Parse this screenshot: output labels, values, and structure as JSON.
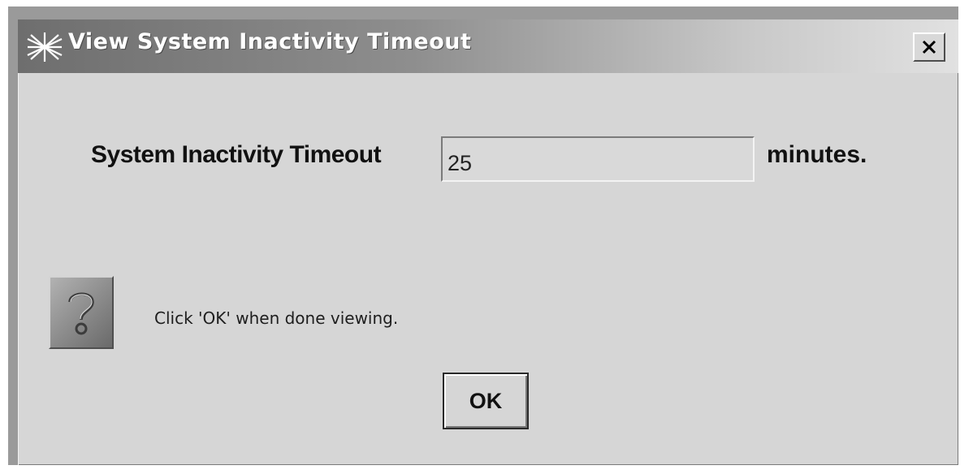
{
  "window": {
    "title": "View System Inactivity Timeout",
    "app_icon": "asterisk-logo-icon",
    "close_icon": "close-icon"
  },
  "form": {
    "field_label": "System Inactivity Timeout",
    "timeout_value": "25",
    "units_label": "minutes."
  },
  "help": {
    "icon": "question-icon",
    "message": "Click 'OK' when done viewing."
  },
  "actions": {
    "ok_label": "OK"
  }
}
